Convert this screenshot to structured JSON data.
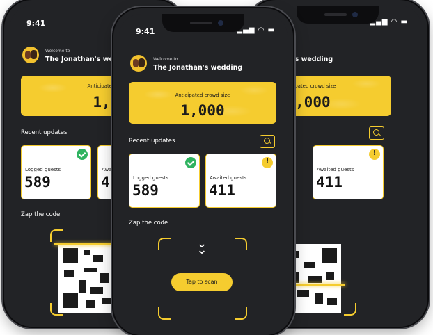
{
  "status": {
    "time": "9:41",
    "signal_icon": "signal-wifi-battery-icon"
  },
  "header": {
    "welcome": "Welcome to",
    "event_name": "The Jonathan's wedding"
  },
  "crowd": {
    "label": "Anticipated crowd size",
    "value": "1,000"
  },
  "recent": {
    "title": "Recent updates",
    "search_icon": "search-icon"
  },
  "stats": [
    {
      "label": "Logged guests",
      "value": "589",
      "badge": "check-icon"
    },
    {
      "label": "Awaited guests",
      "value": "411",
      "badge": "warning-icon"
    }
  ],
  "scan": {
    "title": "Zap the code",
    "button": "Tap to scan",
    "chevron_icon": "double-chevron-down-icon"
  },
  "colors": {
    "accent": "#f5cc2f",
    "background": "#222326",
    "success": "#2fb360"
  }
}
